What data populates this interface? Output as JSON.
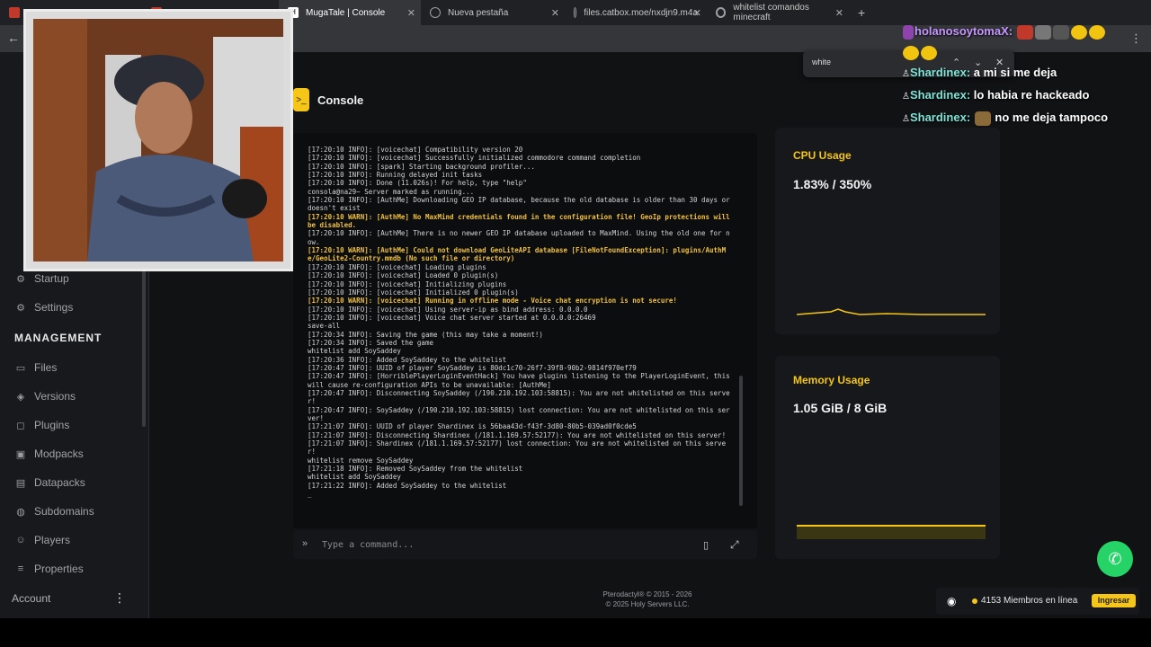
{
  "browser": {
    "tabs": [
      {
        "label": "",
        "icon": "red-icon",
        "color": "#c0392b"
      },
      {
        "label": "",
        "icon": "red-icon",
        "color": "#c0392b"
      },
      {
        "label": "MugaTale | Console",
        "icon": "app-icon",
        "color": "#ffffff",
        "active": true
      },
      {
        "label": "Nueva pestaña",
        "icon": "chrome-icon",
        "color": "#9aa0a6"
      },
      {
        "label": "files.catbox.moe/nxdjn9.m4a",
        "icon": "globe-icon",
        "color": "#9aa0a6"
      },
      {
        "label": "whitelist comandos minecraft",
        "icon": "google-icon",
        "color": "#9aa0a6"
      }
    ],
    "new_tab": "+"
  },
  "find_bar": {
    "value": "white"
  },
  "sidebar": {
    "items_top": [
      {
        "label": "Startup",
        "icon": "startup-icon"
      },
      {
        "label": "Settings",
        "icon": "settings-icon"
      }
    ],
    "management_heading": "MANAGEMENT",
    "management_items": [
      {
        "label": "Files",
        "icon": "folder-icon"
      },
      {
        "label": "Versions",
        "icon": "versions-icon"
      },
      {
        "label": "Plugins",
        "icon": "plugin-icon"
      },
      {
        "label": "Modpacks",
        "icon": "modpack-icon"
      },
      {
        "label": "Datapacks",
        "icon": "datapack-icon"
      },
      {
        "label": "Subdomains",
        "icon": "globe-icon"
      },
      {
        "label": "Players",
        "icon": "players-icon"
      },
      {
        "label": "Properties",
        "icon": "properties-icon"
      }
    ],
    "account": "Account"
  },
  "console": {
    "title": "Console",
    "input_placeholder": "Type a command...",
    "lines": [
      {
        "t": "[17:20:10 INFO]: [voicechat] Compatibility version 20"
      },
      {
        "t": "[17:20:10 INFO]: [voicechat] Successfully initialized commodore command completion"
      },
      {
        "t": "[17:20:10 INFO]: [spark] Starting background profiler..."
      },
      {
        "t": "[17:20:10 INFO]: Running delayed init tasks"
      },
      {
        "t": "[17:20:10 INFO]: Done (11.026s)! For help, type \"help\""
      },
      {
        "t": "consola@na29~ Server marked as running..."
      },
      {
        "t": "[17:20:10 INFO]: [AuthMe] Downloading GEO IP database, because the old database is older than 30 days or doesn't exist"
      },
      {
        "t": "[17:20:10 WARN]: [AuthMe] No MaxMind credentials found in the configuration file! GeoIp protections will be disabled.",
        "warn": true
      },
      {
        "t": "[17:20:10 INFO]: [AuthMe] There is no newer GEO IP database uploaded to MaxMind. Using the old one for now."
      },
      {
        "t": "[17:20:10 WARN]: [AuthMe] Could not download GeoLiteAPI database [FileNotFoundException]: plugins/AuthMe/GeoLite2-Country.mmdb (No such file or directory)",
        "warn": true
      },
      {
        "t": "[17:20:10 INFO]: [voicechat] Loading plugins"
      },
      {
        "t": "[17:20:10 INFO]: [voicechat] Loaded 0 plugin(s)"
      },
      {
        "t": "[17:20:10 INFO]: [voicechat] Initializing plugins"
      },
      {
        "t": "[17:20:10 INFO]: [voicechat] Initialized 0 plugin(s)"
      },
      {
        "t": "[17:20:10 WARN]: [voicechat] Running in offline mode - Voice chat encryption is not secure!",
        "warn": true
      },
      {
        "t": "[17:20:10 INFO]: [voicechat] Using server-ip as bind address: 0.0.0.0"
      },
      {
        "t": "[17:20:10 INFO]: [voicechat] Voice chat server started at 0.0.0.0:26469"
      },
      {
        "t": "save-all"
      },
      {
        "t": "[17:20:34 INFO]: Saving the game (this may take a moment!)"
      },
      {
        "t": "[17:20:34 INFO]: Saved the game"
      },
      {
        "t": "whitelist add SoySaddey"
      },
      {
        "t": "[17:20:36 INFO]: Added SoySaddey to the whitelist"
      },
      {
        "t": "[17:20:47 INFO]: UUID of player SoySaddey is 80dc1c70-26f7-39f8-90b2-9814f970ef79"
      },
      {
        "t": "[17:20:47 INFO]: [HorriblePlayerLoginEventHack] You have plugins listening to the PlayerLoginEvent, this will cause re-configuration APIs to be unavailable: [AuthMe]"
      },
      {
        "t": "[17:20:47 INFO]: Disconnecting SoySaddey (/190.210.192.103:58815): You are not whitelisted on this server!"
      },
      {
        "t": "[17:20:47 INFO]: SoySaddey (/190.210.192.103:58815) lost connection: You are not whitelisted on this server!"
      },
      {
        "t": "[17:21:07 INFO]: UUID of player Shardinex is 56baa43d-f43f-3d80-80b5-039ad0f0cde5"
      },
      {
        "t": "[17:21:07 INFO]: Disconnecting Shardinex (/181.1.169.57:52177): You are not whitelisted on this server!"
      },
      {
        "t": "[17:21:07 INFO]: Shardinex (/181.1.169.57:52177) lost connection: You are not whitelisted on this server!"
      },
      {
        "t": "whitelist remove SoySaddey"
      },
      {
        "t": "[17:21:18 INFO]: Removed SoySaddey from the whitelist"
      },
      {
        "t": "whitelist add SoySaddey"
      },
      {
        "t": "[17:21:22 INFO]: Added SoySaddey to the whitelist"
      },
      {
        "t": "_"
      }
    ]
  },
  "stats": {
    "cpu": {
      "title": "CPU Usage",
      "value": "1.83% / 350%"
    },
    "memory": {
      "title": "Memory Usage",
      "value": "1.05 GiB / 8 GiB"
    }
  },
  "chat": {
    "top_partial": "holanosoytomaX:",
    "messages": [
      {
        "user": "Shardinex:",
        "text": "a mi si me deja"
      },
      {
        "user": "Shardinex:",
        "text": "lo habia re hackeado"
      },
      {
        "user": "Shardinex:",
        "text": "no me deja tampoco"
      }
    ]
  },
  "footer": {
    "line1": "Pterodactyl® © 2015 - 2026",
    "line2": "© 2025 Holy Servers LLC."
  },
  "discord": {
    "members": "4153 Miembros en línea",
    "button": "Ingresar"
  },
  "colors": {
    "accent": "#f5c518",
    "whatsapp": "#25d366"
  }
}
